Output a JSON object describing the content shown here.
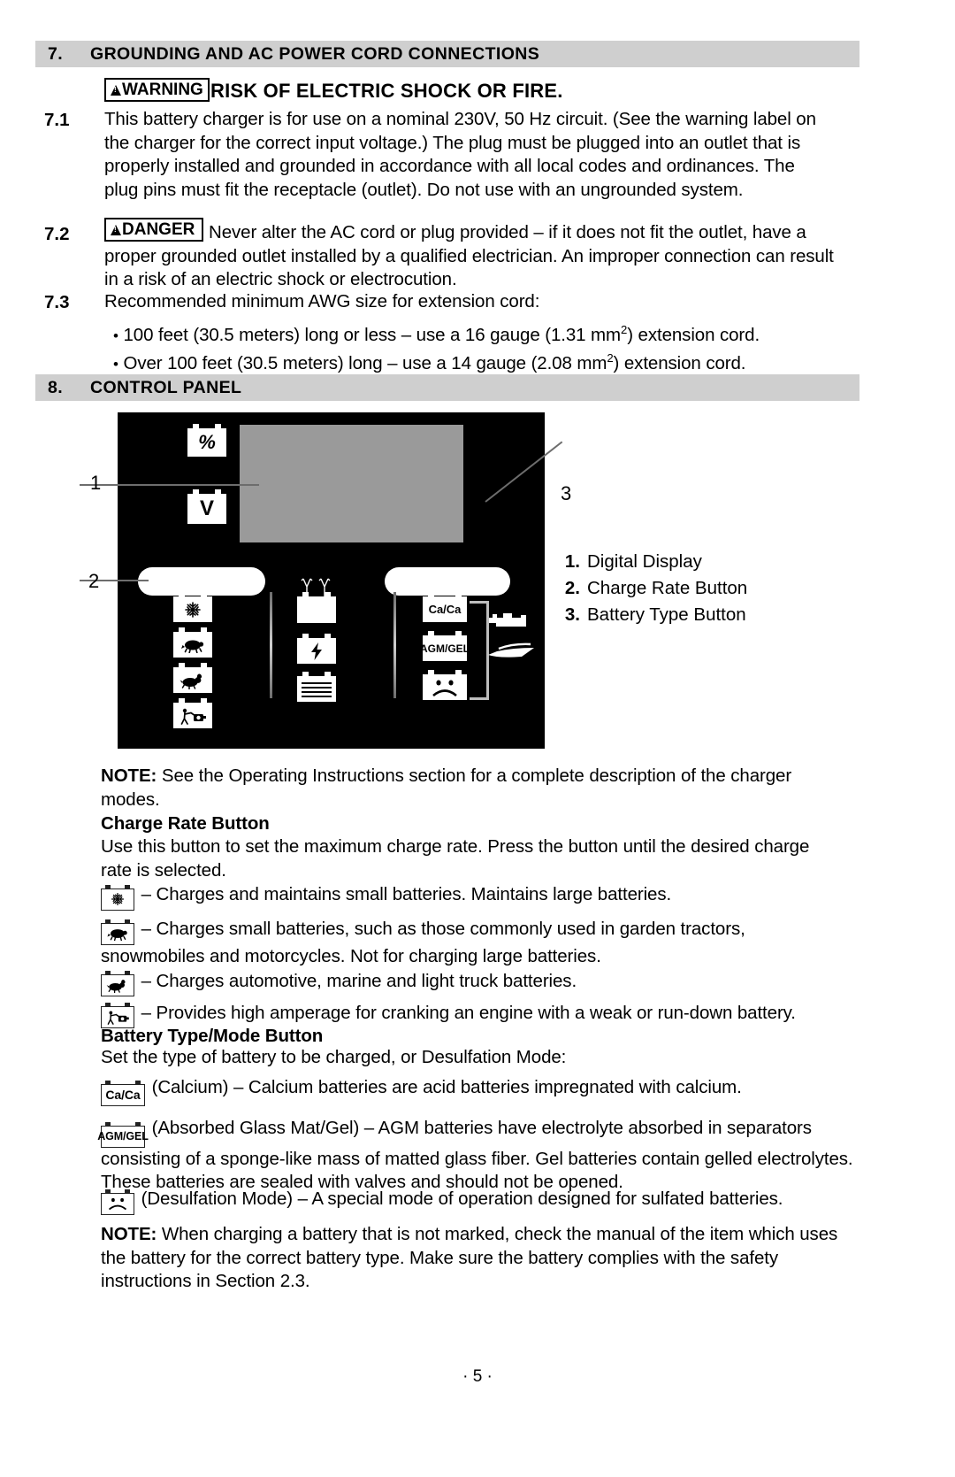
{
  "sections": [
    {
      "number": "7.",
      "title": "GROUNDING AND AC POWER CORD CONNECTIONS"
    },
    {
      "number": "8.",
      "title": "CONTROL PANEL"
    }
  ],
  "warning": {
    "badge": "WARNING",
    "headline": "RISK OF ELECTRIC SHOCK OR FIRE."
  },
  "danger": {
    "badge": "DANGER"
  },
  "clauses": {
    "c71_num": "7.1",
    "c71_text": "This battery charger is for use on a nominal 230V, 50 Hz circuit. (See the warning label on the charger for the correct input voltage.) The plug must be plugged into an outlet that is properly installed and grounded in accordance with all local codes and ordinances. The plug pins must fit the receptacle (outlet). Do not use with an ungrounded system.",
    "c72_num": "7.2",
    "c72_text": "Never alter the AC cord or plug provided – if it does not fit the outlet, have a proper grounded outlet installed by a qualified electrician. An improper connection can result in a risk of an electric shock or electrocution.",
    "c73_num": "7.3",
    "c73_text": "Recommended minimum AWG size for extension cord:",
    "bullet1_pre": "100 feet (30.5 meters) long or less – use a 16 gauge (1.31 mm",
    "bullet1_sup": "2",
    "bullet1_post": ") extension cord.",
    "bullet2_pre": "Over 100 feet (30.5 meters) long – use a 14 gauge (2.08 mm",
    "bullet2_sup": "2",
    "bullet2_post": ") extension cord."
  },
  "panel": {
    "pct_icon_label": "%",
    "volt_icon_label": "V",
    "type_calcium_label": "Ca/Ca",
    "type_agm_label": "AGM/GEL",
    "callout_1": "1",
    "callout_2": "2",
    "callout_3": "3",
    "icon_names": {
      "display": "digital-display",
      "charge_rate_button": "charge-rate-button",
      "battery_type_button": "battery-type-button",
      "snowflake": "snowflake-battery-icon",
      "turtle": "turtle-battery-icon",
      "rabbit": "rabbit-battery-icon",
      "engine_crank": "engine-crank-battery-icon",
      "clamps": "battery-clamps-icon",
      "bolt": "charging-bolt-battery-icon",
      "charged": "charged-battery-icon",
      "calcium": "calcium-battery-icon",
      "agm_gel": "agm-gel-battery-icon",
      "desulfation": "desulfation-sad-battery-icon",
      "engine": "engine-icon",
      "boat": "boat-icon"
    }
  },
  "legend": {
    "items": [
      {
        "key": "1.",
        "label": "Digital Display"
      },
      {
        "key": "2.",
        "label": "Charge Rate Button"
      },
      {
        "key": "3.",
        "label": "Battery Type Button"
      }
    ]
  },
  "notes": {
    "note1_label": "NOTE:",
    "note1_text": " See the Operating Instructions section for a complete description of the charger modes.",
    "note2_label": "NOTE:",
    "note2_text": " When charging a battery that is not marked, check the manual of the item which uses the battery for the correct battery type. Make sure the battery complies with the safety instructions in Section 2.3."
  },
  "charge_rate": {
    "heading": "Charge Rate Button",
    "intro": "Use this button to set the maximum charge rate. Press the button until the desired charge rate is selected.",
    "items": [
      {
        "icon": "snowflake",
        "text": "– Charges and maintains small batteries. Maintains large batteries."
      },
      {
        "icon": "turtle",
        "text": "– Charges small batteries, such as those commonly used in garden tractors, snowmobiles and motorcycles. Not for charging large batteries."
      },
      {
        "icon": "rabbit",
        "text": "– Charges automotive, marine and light truck batteries."
      },
      {
        "icon": "engine-crank",
        "text": "– Provides high amperage for cranking an engine with a weak or run-down battery."
      }
    ]
  },
  "battery_type": {
    "heading": "Battery Type/Mode Button",
    "intro": "Set the type of battery to be charged, or Desulfation Mode:",
    "items": [
      {
        "icon_label": "Ca/Ca",
        "text": "(Calcium) – Calcium batteries are acid batteries impregnated with calcium."
      },
      {
        "icon_label": "AGM/GEL",
        "text": "(Absorbed Glass Mat/Gel) – AGM batteries have electrolyte absorbed in separators consisting of a sponge-like mass of matted glass fiber. Gel batteries contain gelled electrolytes. These batteries are sealed with valves and should not be opened."
      },
      {
        "icon_label": "",
        "text": "(Desulfation Mode) – A special mode of operation designed for sulfated batteries."
      }
    ]
  },
  "footer": {
    "page": "· 5 ·"
  },
  "colors": {
    "header_bar": "#cfcfcf",
    "panel_background": "#000000",
    "lcd": "#9a9a9a",
    "leader_line": "#6d6d6d"
  }
}
